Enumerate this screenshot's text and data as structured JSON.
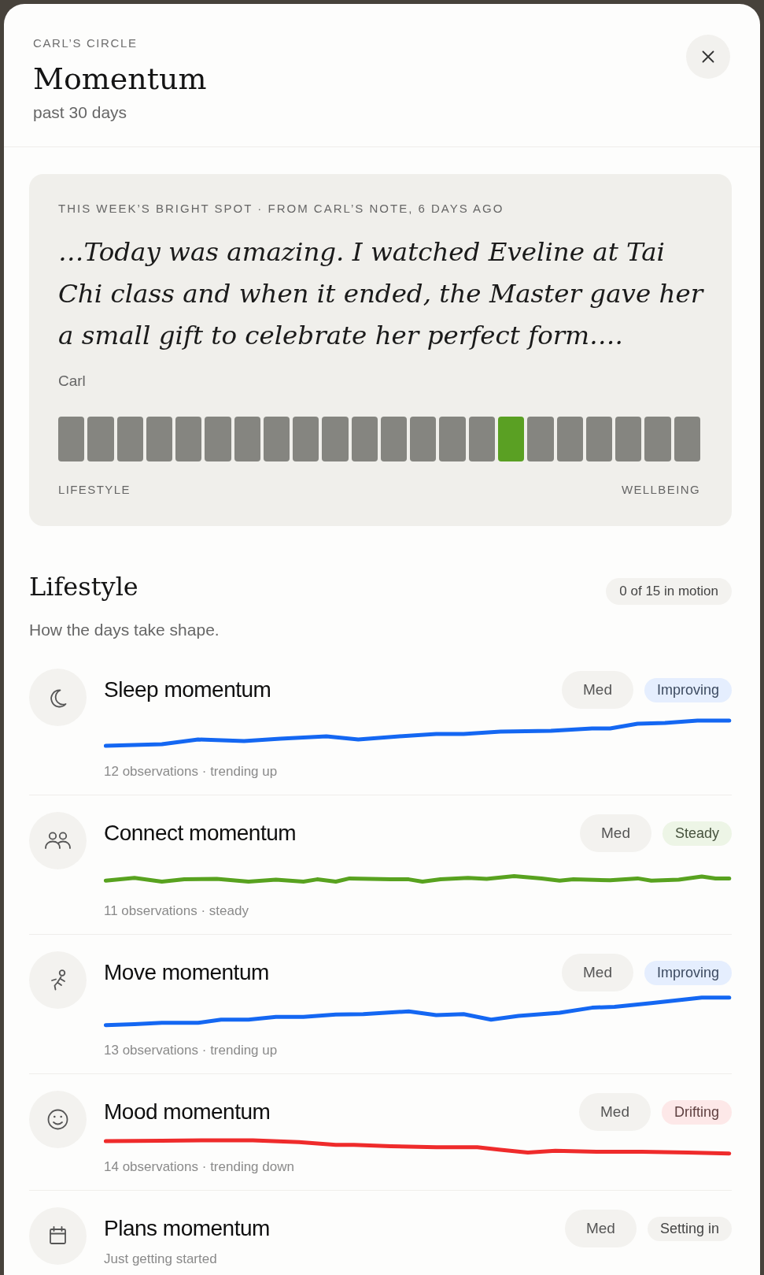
{
  "header": {
    "eyebrow": "CARL’S CIRCLE",
    "title": "Momentum",
    "subtitle": "past 30 days"
  },
  "bright_spot": {
    "label": "THIS WEEK’S BRIGHT SPOT · FROM CARL’S NOTE, 6 DAYS AGO",
    "quote": "…Today was amazing. I watched Eveline at Tai Chi class and when it ended, the Master gave her a small gift to celebrate her perfect form….",
    "author": "Carl",
    "scale": {
      "segments": [
        {
          "selected": false
        },
        {
          "selected": false
        },
        {
          "selected": false
        },
        {
          "selected": false
        },
        {
          "selected": false
        },
        {
          "selected": false
        },
        {
          "selected": false
        },
        {
          "selected": false
        },
        {
          "selected": false
        },
        {
          "selected": false
        },
        {
          "selected": false
        },
        {
          "selected": false
        },
        {
          "selected": false
        },
        {
          "selected": false
        },
        {
          "selected": false
        },
        {
          "selected": true
        },
        {
          "selected": false
        },
        {
          "selected": false
        },
        {
          "selected": false
        },
        {
          "selected": false
        },
        {
          "selected": false
        },
        {
          "selected": false
        }
      ],
      "left_label": "LIFESTYLE",
      "right_label": "WELLBEING"
    }
  },
  "section": {
    "title": "Lifestyle",
    "count": "0 of 15 in motion",
    "subtitle": "How the days take shape.",
    "rows": [
      {
        "kind": "sparkline",
        "title": "Sleep momentum",
        "rating": "Med",
        "status": "Improving",
        "color": "#1467f2",
        "caption": "12 observations · trending up"
      },
      {
        "kind": "sparkline",
        "title": "Connect momentum",
        "rating": "Med",
        "status": "Steady",
        "color": "#58a21f",
        "caption": "11 observations · steady"
      },
      {
        "kind": "sparkline",
        "title": "Move momentum",
        "rating": "Med",
        "status": "Improving",
        "color": "#1467f2",
        "caption": "13 observations · trending up"
      },
      {
        "kind": "sparkline",
        "title": "Mood momentum",
        "rating": "Med",
        "status": "Drifting",
        "color": "#ef2b2b",
        "caption": "14 observations · trending down"
      },
      {
        "kind": "pending",
        "title": "Plans momentum",
        "rating": "Med",
        "status": "Setting in",
        "caption": "Just getting started"
      }
    ]
  }
}
